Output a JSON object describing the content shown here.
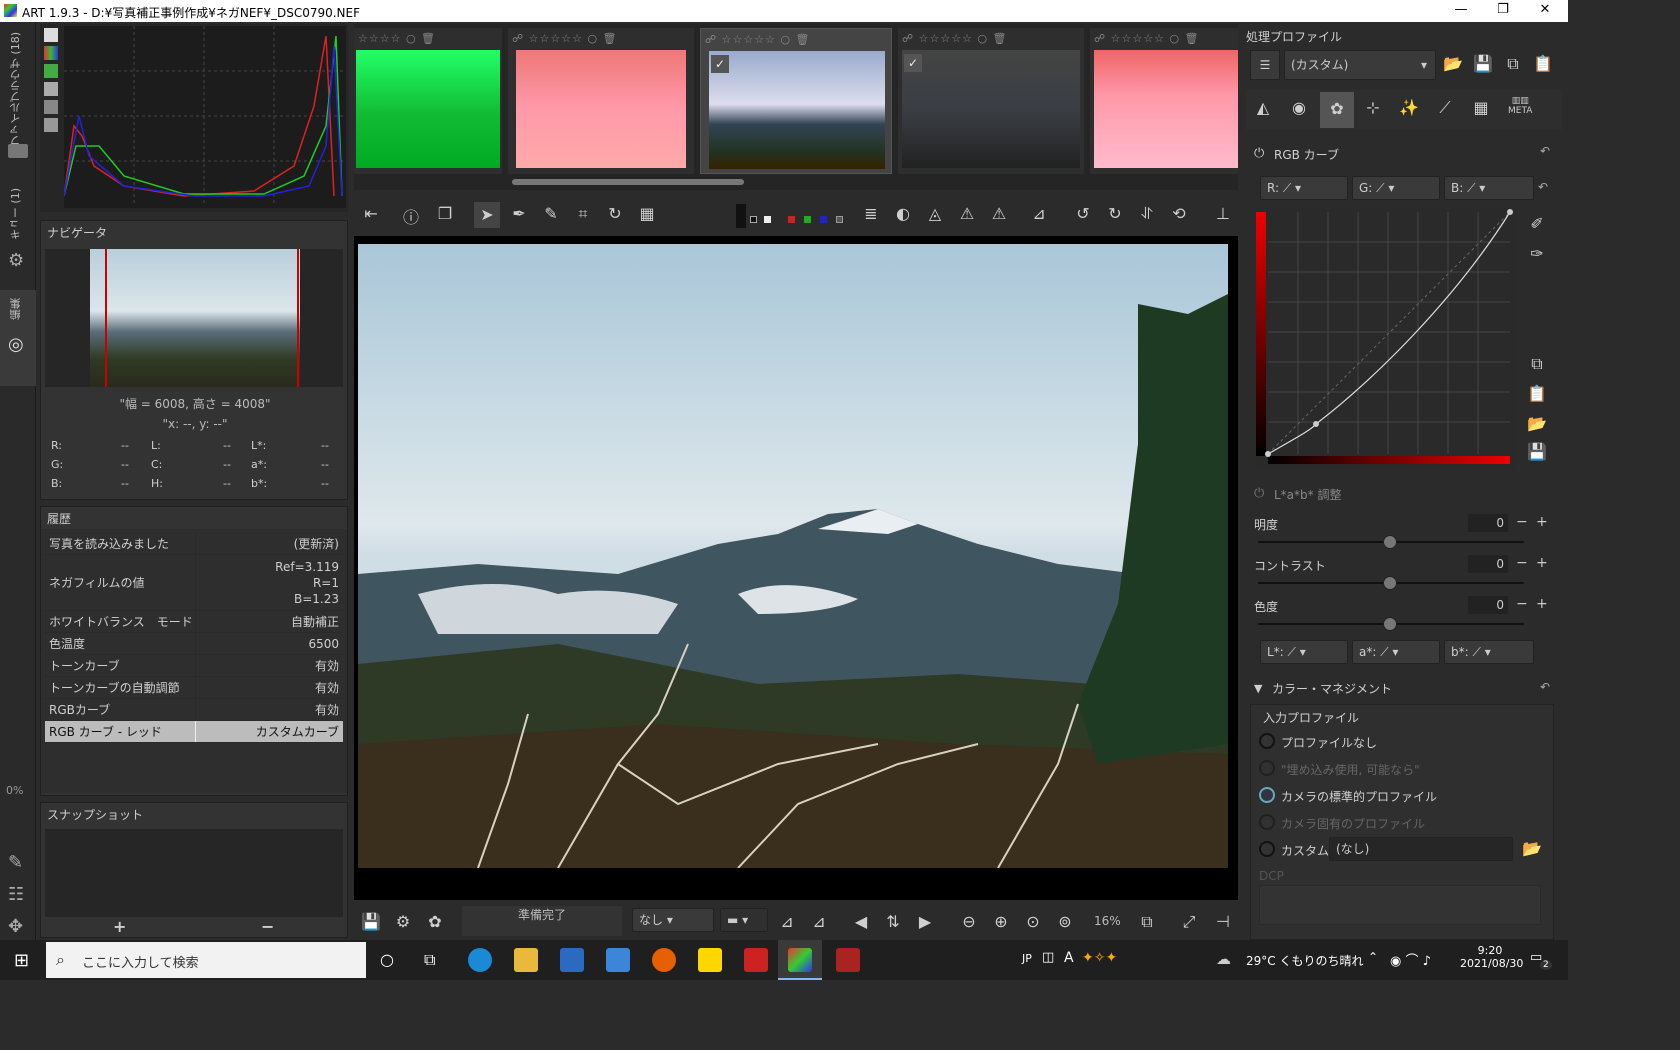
{
  "window": {
    "title": "ART 1.9.3 - D:¥写真補正事例作成¥ネガNEF¥_DSC0790.NEF",
    "min": "—",
    "max": "❐",
    "close": "✕"
  },
  "leftstrip": {
    "file_browser": "ファイルブラウザ (18)",
    "queue": "キュー (1)",
    "editor": "編集",
    "zoom_pct": "0%"
  },
  "navigator": {
    "title": "ナビゲータ",
    "size": "\"幅 = 6008, 高さ = 4008\"",
    "coords": "\"x: --, y: --\"",
    "cols": [
      [
        "R:",
        "--"
      ],
      [
        "G:",
        "--"
      ],
      [
        "B:",
        "--"
      ],
      [
        "L:",
        "--"
      ],
      [
        "C:",
        "--"
      ],
      [
        "H:",
        "--"
      ],
      [
        "L*:",
        "--"
      ],
      [
        "a*:",
        "--"
      ],
      [
        "b*:",
        "--"
      ]
    ]
  },
  "history": {
    "title": "履歴",
    "rows": [
      {
        "k": "写真を読み込みました",
        "v": "(更新済)"
      },
      {
        "k": "ネガフィルムの値",
        "v": "Ref=3.119\nR=1\nB=1.23"
      },
      {
        "k": "ホワイトバランス　モード",
        "v": "自動補正"
      },
      {
        "k": "色温度",
        "v": "6500"
      },
      {
        "k": "トーンカーブ",
        "v": "有効"
      },
      {
        "k": "トーンカーブの自動調節",
        "v": "有効"
      },
      {
        "k": "RGBカーブ",
        "v": "有効"
      },
      {
        "k": "RGB カーブ - レッド",
        "v": "カスタムカーブ"
      }
    ]
  },
  "snapshot": {
    "title": "スナップショット",
    "add": "+",
    "remove": "−"
  },
  "bottombar": {
    "status": "準備完了",
    "preset": "なし",
    "zoom": "16%"
  },
  "right": {
    "profile_title": "処理プロファイル",
    "profile_value": "(カスタム)",
    "meta": "META",
    "rgb_curve": "RGB カーブ",
    "r": "R:",
    "g": "G:",
    "b": "B:",
    "lab_title": "L*a*b* 調整",
    "brightness": "明度",
    "contrast": "コントラスト",
    "chroma": "色度",
    "brightness_v": "0",
    "contrast_v": "0",
    "chroma_v": "0",
    "lab_l": "L*:",
    "lab_a": "a*:",
    "lab_b": "b*:",
    "cm_title": "カラー・マネジメント",
    "input_profile": "入力プロファイル",
    "opt_none": "プロファイルなし",
    "opt_embedded": "\"埋め込み使用, 可能なら\"",
    "opt_camera": "カメラの標準的プロファイル",
    "opt_camera_specific": "カメラ固有のプロファイル",
    "opt_custom": "カスタム:",
    "custom_value": "(なし)",
    "dcp": "DCP"
  },
  "taskbar": {
    "search": "ここに入力して検索",
    "lang": "JP",
    "ime": "A",
    "weather": "29°C くもりのち晴れ",
    "time": "9:20",
    "date": "2021/08/30",
    "notif": "2"
  }
}
